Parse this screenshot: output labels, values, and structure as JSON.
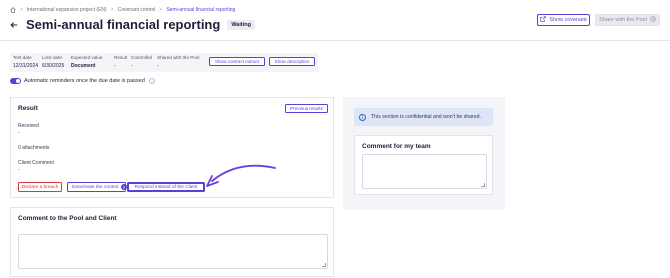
{
  "breadcrumb": {
    "items": [
      "International expansion project (EN)",
      "Covenant control",
      "Semi-annual financial reporting"
    ]
  },
  "header": {
    "title": "Semi-annual financial reporting",
    "status": "Waiting",
    "show_covenant_label": "Show covenant",
    "share_pool_label": "Share with the Pool"
  },
  "info": {
    "test_date_label": "Test date",
    "test_date_value": "12/31/2024",
    "limit_date_label": "Limit date",
    "limit_date_value": "6/30/2025",
    "expected_value_label": "Expected value",
    "expected_value_value": "Document",
    "result_label": "Result",
    "result_value": "-",
    "controlled_label": "Controlled",
    "controlled_value": "-",
    "shared_label": "Shared with the Pool",
    "shared_value": "-",
    "show_contract_extract_label": "Show contract extract",
    "show_description_label": "Show description"
  },
  "reminders": {
    "label": "Automatic reminders once the due date is passed",
    "enabled": true
  },
  "result_card": {
    "title": "Result",
    "previous_results_label": "Previous results",
    "received_label": "Received",
    "received_value": "-",
    "attachments_label": "0 attachments",
    "client_comment_label": "Client Comment",
    "client_comment_value": "-",
    "declare_breach_label": "Declare a breach",
    "deactivate_label": "Deactivate the control",
    "deactivate_badge": "?",
    "respond_label": "Respond instead of the Client"
  },
  "comment_card": {
    "title": "Comment to the Pool and Client"
  },
  "side_panel": {
    "confidential_text": "This section is confidential and won't be shared.",
    "team_comment_title": "Comment for my team"
  },
  "colors": {
    "accent": "#5b3fd6",
    "danger": "#d23c3c",
    "info_bg": "#dce6f6",
    "panel_bg": "#f5f5f9"
  }
}
